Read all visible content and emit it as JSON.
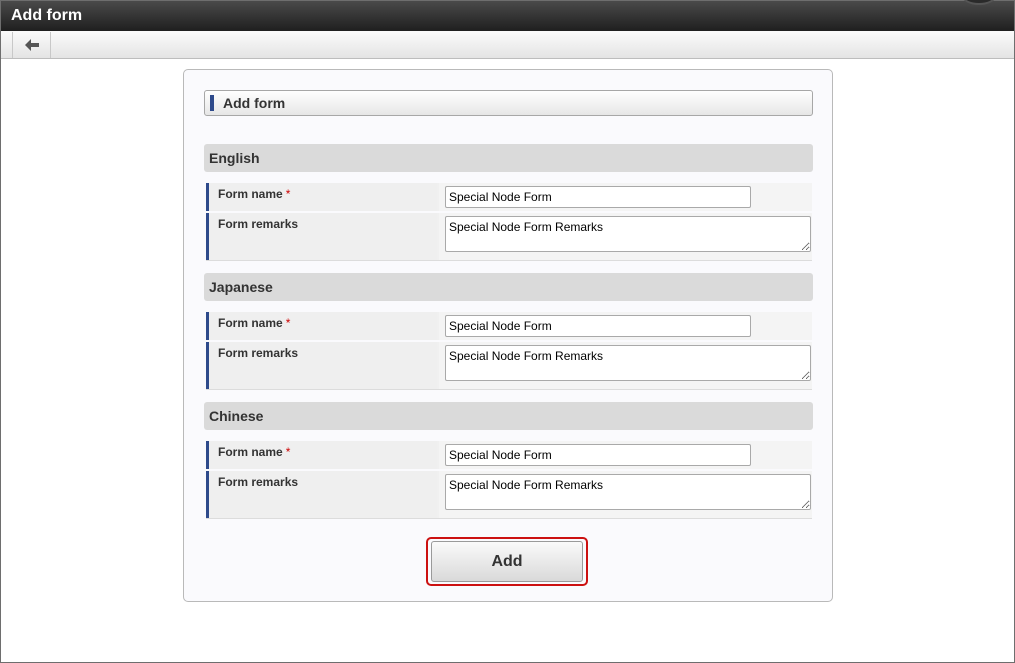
{
  "window": {
    "title": "Add form"
  },
  "toolbar": {
    "back_icon": "arrow-left-icon"
  },
  "panel": {
    "header_title": "Add form",
    "sections": [
      {
        "heading": "English",
        "form_name_label": "Form name",
        "required_mark": "*",
        "form_name_value": "Special Node Form",
        "form_remarks_label": "Form remarks",
        "form_remarks_value": "Special Node Form Remarks"
      },
      {
        "heading": "Japanese",
        "form_name_label": "Form name",
        "required_mark": "*",
        "form_name_value": "Special Node Form",
        "form_remarks_label": "Form remarks",
        "form_remarks_value": "Special Node Form Remarks"
      },
      {
        "heading": "Chinese",
        "form_name_label": "Form name",
        "required_mark": "*",
        "form_name_value": "Special Node Form",
        "form_remarks_label": "Form remarks",
        "form_remarks_value": "Special Node Form Remarks"
      }
    ],
    "add_label": "Add"
  },
  "colors": {
    "accent_bar": "#2e4a8b",
    "required": "#cc0000",
    "highlight": "#cc1111"
  }
}
